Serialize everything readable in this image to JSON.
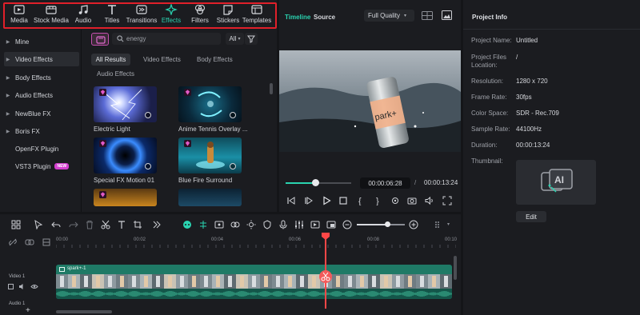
{
  "toolbar": {
    "items": [
      {
        "label": "Media",
        "icon": "media-icon"
      },
      {
        "label": "Stock Media",
        "icon": "stock-media-icon"
      },
      {
        "label": "Audio",
        "icon": "music-note-icon"
      },
      {
        "label": "Titles",
        "icon": "text-t-icon"
      },
      {
        "label": "Transitions",
        "icon": "transitions-icon"
      },
      {
        "label": "Effects",
        "icon": "sparkle-icon",
        "active": true
      },
      {
        "label": "Filters",
        "icon": "filters-icon"
      },
      {
        "label": "Stickers",
        "icon": "sticker-icon"
      },
      {
        "label": "Templates",
        "icon": "templates-icon"
      }
    ],
    "highlight_color": "#e0202a",
    "accent_color": "#2ad3b0"
  },
  "sidebar": {
    "items": [
      {
        "label": "Mine",
        "arrow": true
      },
      {
        "label": "Video Effects",
        "arrow": true,
        "selected": true
      },
      {
        "label": "Body Effects",
        "arrow": true
      },
      {
        "label": "Audio Effects",
        "arrow": true
      },
      {
        "label": "NewBlue FX",
        "arrow": true
      },
      {
        "label": "Boris FX",
        "arrow": true
      },
      {
        "label": "OpenFX Plugin",
        "arrow": false
      },
      {
        "label": "VST3 Plugin",
        "arrow": false,
        "badge": "NEW"
      }
    ]
  },
  "search": {
    "value": "energy",
    "filter_label": "All"
  },
  "categories": [
    "All Results",
    "Video Effects",
    "Body Effects",
    "Audio Effects"
  ],
  "effects": [
    {
      "label": "Electric Light"
    },
    {
      "label": "Anime Tennis Overlay ..."
    },
    {
      "label": "Special FX Motion 01"
    },
    {
      "label": "Blue Fire Surround"
    }
  ],
  "preview": {
    "tab_timeline": "Timeline",
    "tab_source": "Source",
    "quality": "Full Quality",
    "current_time": "00:00:06:28",
    "separator": "/",
    "total_time": "00:00:13:24",
    "progress": 0.45,
    "can_text": "park+"
  },
  "info": {
    "title": "Project Info",
    "rows": [
      {
        "key": "Project Name:",
        "value": "Untitled"
      },
      {
        "key": "Project Files Location:",
        "value": "/"
      },
      {
        "key": "Resolution:",
        "value": "1280 x 720"
      },
      {
        "key": "Frame Rate:",
        "value": "30fps"
      },
      {
        "key": "Color Space:",
        "value": "SDR - Rec.709"
      },
      {
        "key": "Sample Rate:",
        "value": "44100Hz"
      },
      {
        "key": "Duration:",
        "value": "00:00:13:24"
      },
      {
        "key": "Thumbnail:",
        "value": ""
      }
    ],
    "edit_label": "Edit"
  },
  "timeline": {
    "ticks": [
      "00:00",
      "00:02",
      "00:04",
      "00:06",
      "00:08",
      "00:10"
    ],
    "clip_name": "spark+-1",
    "video_track": "Video 1",
    "audio_track": "Audio 1",
    "zoom_level": 0.63
  }
}
